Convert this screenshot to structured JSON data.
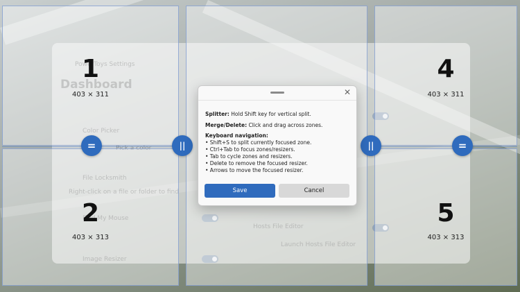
{
  "background_app": {
    "window_title": "PowerToys Settings",
    "heading": "Dashboard",
    "modules": [
      {
        "name": "Color Picker",
        "shortcut": "Pick a color"
      },
      {
        "name": "File Locksmith",
        "description": "Right-click on a file or folder to find which processes are using it"
      },
      {
        "name": "Find My Mouse"
      },
      {
        "name": "Image Resizer"
      },
      {
        "name": "Hosts File Editor",
        "description": "Launch Hosts File Editor"
      }
    ]
  },
  "zones": [
    {
      "number": "1",
      "size": "403 × 311"
    },
    {
      "number": "2",
      "size": "403 × 313"
    },
    {
      "number": "4",
      "size": "403 × 311"
    },
    {
      "number": "5",
      "size": "403 × 313"
    }
  ],
  "resizers": {
    "horizontal_glyph": "=",
    "vertical_glyph": "||"
  },
  "dialog": {
    "splitter_label": "Splitter:",
    "splitter_text": "Hold Shift key for vertical split.",
    "merge_label": "Merge/Delete:",
    "merge_text": "Click and drag across zones.",
    "nav_label": "Keyboard navigation:",
    "nav_items": [
      "• Shift+S to split currently focused zone.",
      "• Ctrl+Tab to focus zones/resizers.",
      "• Tab to cycle zones and resizers.",
      "• Delete to remove the focused resizer.",
      "• Arrows to move the focused resizer."
    ],
    "save_label": "Save",
    "cancel_label": "Cancel",
    "close_glyph": "✕"
  }
}
